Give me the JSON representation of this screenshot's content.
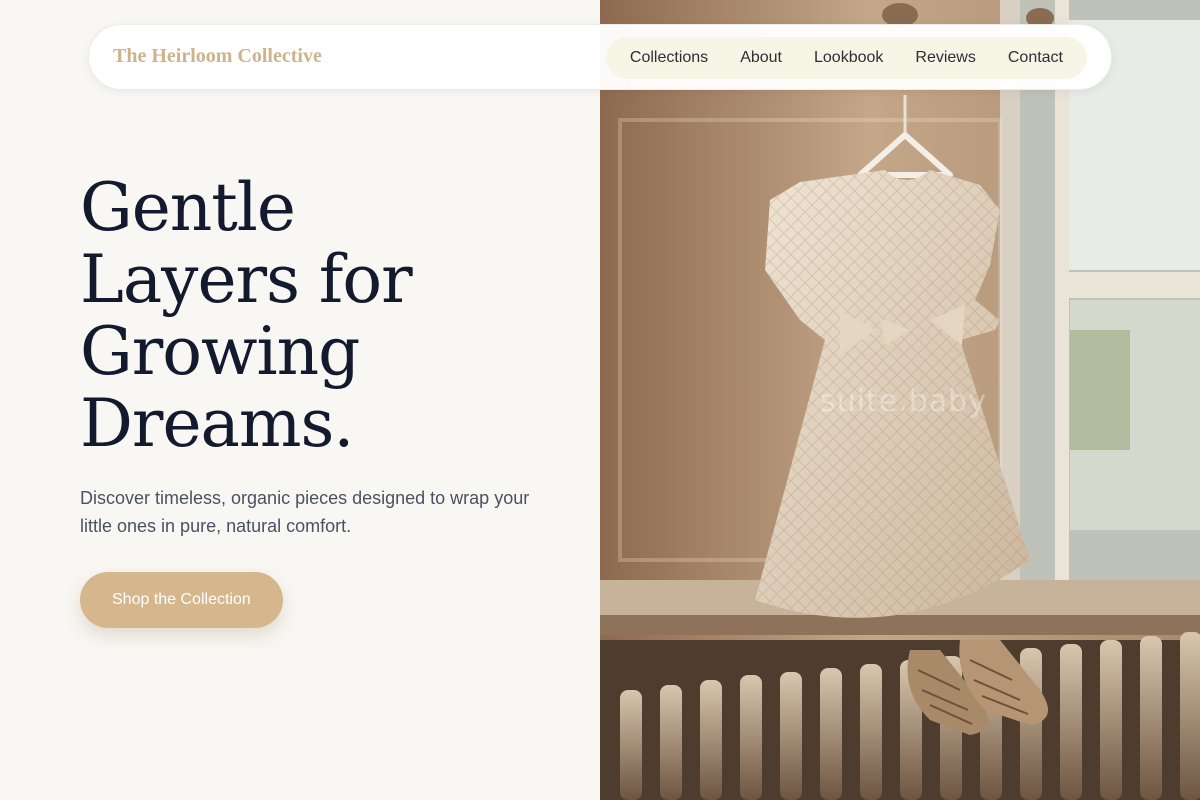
{
  "navbar": {
    "brand": "The Heirloom Collective",
    "links": [
      "Collections",
      "About",
      "Lookbook",
      "Reviews",
      "Contact"
    ]
  },
  "hero": {
    "title_lines": [
      "Gentle",
      "Layers for",
      "Growing",
      "Dreams."
    ],
    "subtitle": "Discover timeless, organic pieces designed to wrap your little ones in pure, natural comfort.",
    "cta_label": "Shop the Collection"
  },
  "photo": {
    "watermark": "suite.baby"
  },
  "colors": {
    "background": "#f9f7f3",
    "accent": "#d6b78d",
    "brand": "#cdb38c",
    "heading": "#141a2e",
    "nav_pill": "#f7f5e6"
  }
}
